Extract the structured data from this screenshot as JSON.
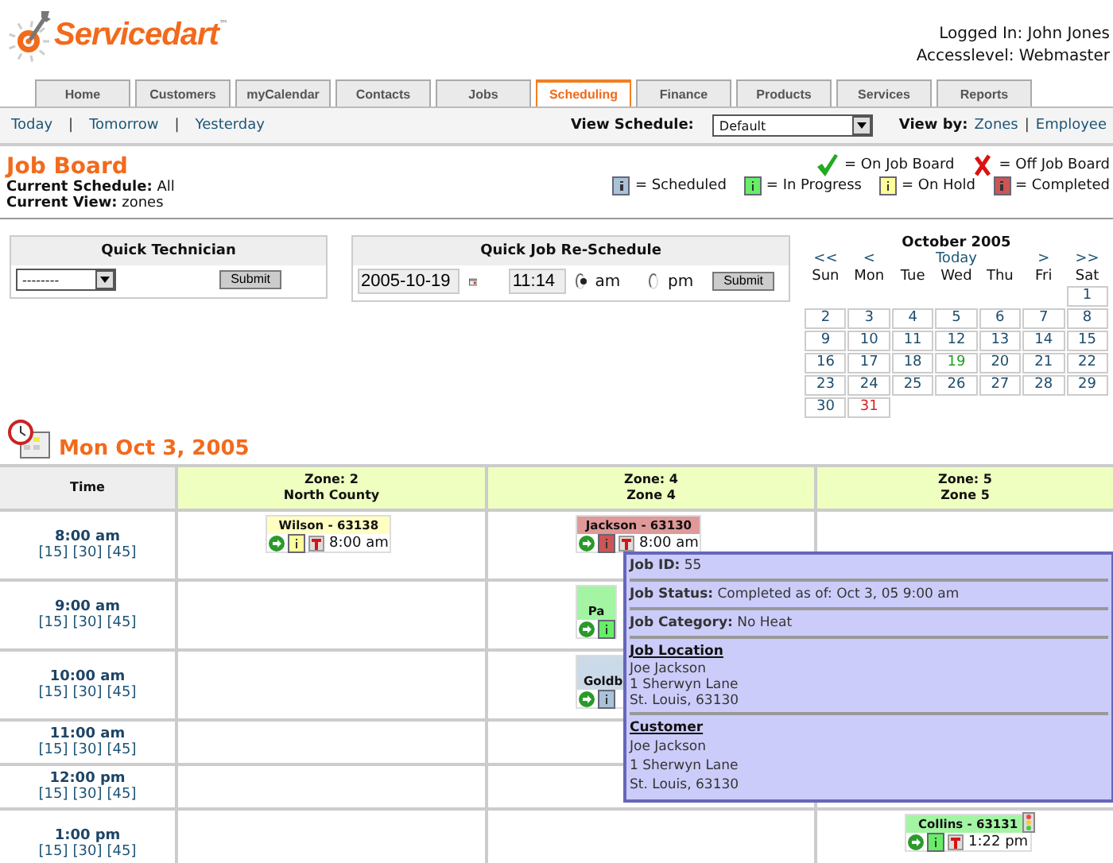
{
  "header": {
    "logo_text": "Servicedart",
    "logo_mark": "™",
    "user_info": [
      "Logged In: John Jones",
      "Accesslevel: Webmaster"
    ]
  },
  "nav_tabs": [
    {
      "label": "Home",
      "selected": false
    },
    {
      "label": "Customers",
      "selected": false
    },
    {
      "label": "myCalendar",
      "selected": false
    },
    {
      "label": "Contacts",
      "selected": false
    },
    {
      "label": "Jobs",
      "selected": false
    },
    {
      "label": "Scheduling",
      "selected": true
    },
    {
      "label": "Finance",
      "selected": false
    },
    {
      "label": "Products",
      "selected": false
    },
    {
      "label": "Services",
      "selected": false
    },
    {
      "label": "Reports",
      "selected": false
    }
  ],
  "subnav": {
    "links": [
      "Today",
      "Tomorrow",
      "Yesterday"
    ],
    "separator": "|",
    "view_schedule": {
      "label": "View Schedule:",
      "value": "Default"
    },
    "view_by": {
      "label": "View by:",
      "options": [
        "Zones",
        "Employee"
      ],
      "separator": "|"
    }
  },
  "job_board": {
    "title": "Job Board",
    "info": [
      {
        "label": "Current Schedule:",
        "value": "All"
      },
      {
        "label": "Current View:",
        "value": "zones"
      }
    ]
  },
  "legend": {
    "board": [
      {
        "kind": "check",
        "text": "= On Job Board"
      },
      {
        "kind": "cross",
        "text": "= Off Job Board"
      }
    ],
    "statuses": [
      {
        "color": "#a9c2d8",
        "text": "= Scheduled"
      },
      {
        "color": "#66ee66",
        "text": "= In Progress"
      },
      {
        "color": "#ffff99",
        "text": "= On Hold"
      },
      {
        "color": "#cc5555",
        "text": "= Completed"
      }
    ]
  },
  "quick_technician": {
    "title": "Quick Technician",
    "select_value": "--------",
    "button": "Submit"
  },
  "quick_reschedule": {
    "title": "Quick Job Re-Schedule",
    "date": "2005-10-19",
    "time": "11:14",
    "radios": [
      {
        "label": "am",
        "selected": true
      },
      {
        "label": "pm",
        "selected": false
      }
    ],
    "button": "Submit"
  },
  "calendar": {
    "title": "October 2005",
    "nav": [
      "<<",
      "<",
      "Today",
      ">",
      ">>"
    ],
    "weekdays": [
      "Sun",
      "Mon",
      "Tue",
      "Wed",
      "Thu",
      "Fri",
      "Sat"
    ],
    "weeks": [
      [
        {
          "label": "1",
          "kind": "day"
        }
      ],
      [
        {
          "label": "2",
          "kind": "day"
        },
        {
          "label": "3",
          "kind": "day"
        },
        {
          "label": "4",
          "kind": "day"
        },
        {
          "label": "5",
          "kind": "day"
        },
        {
          "label": "6",
          "kind": "day"
        },
        {
          "label": "7",
          "kind": "day"
        },
        {
          "label": "8",
          "kind": "day"
        }
      ],
      [
        {
          "label": "9",
          "kind": "day"
        },
        {
          "label": "10",
          "kind": "day"
        },
        {
          "label": "11",
          "kind": "day"
        },
        {
          "label": "12",
          "kind": "day"
        },
        {
          "label": "13",
          "kind": "day"
        },
        {
          "label": "14",
          "kind": "day"
        },
        {
          "label": "15",
          "kind": "day"
        }
      ],
      [
        {
          "label": "16",
          "kind": "day"
        },
        {
          "label": "17",
          "kind": "day"
        },
        {
          "label": "18",
          "kind": "day"
        },
        {
          "label": "19",
          "kind": "today"
        },
        {
          "label": "20",
          "kind": "day"
        },
        {
          "label": "21",
          "kind": "day"
        },
        {
          "label": "22",
          "kind": "day"
        }
      ],
      [
        {
          "label": "23",
          "kind": "day"
        },
        {
          "label": "24",
          "kind": "day"
        },
        {
          "label": "25",
          "kind": "day"
        },
        {
          "label": "26",
          "kind": "day"
        },
        {
          "label": "27",
          "kind": "day"
        },
        {
          "label": "28",
          "kind": "day"
        },
        {
          "label": "29",
          "kind": "day"
        }
      ],
      [
        {
          "label": "30",
          "kind": "day"
        },
        {
          "label": "31",
          "kind": "marked"
        }
      ]
    ]
  },
  "schedule": {
    "date_title": "Mon Oct 3, 2005",
    "time_header": "Time",
    "zones": [
      [
        "Zone: 2",
        "North County"
      ],
      [
        "Zone: 4",
        "Zone 4"
      ],
      [
        "Zone: 5",
        "Zone 5"
      ]
    ],
    "rows": [
      {
        "time": "8:00 am",
        "quarters": [
          "[15]",
          "[30]",
          "[45]"
        ],
        "cells": [
          [
            {
              "title": "Wilson - 63138",
              "color": "#ffff99",
              "time": "8:00 am"
            }
          ],
          [
            {
              "title": "Jackson - 63130",
              "color": "#cc5555",
              "time": "8:00 am"
            }
          ],
          []
        ]
      },
      {
        "time": "9:00 am",
        "quarters": [
          "[15]",
          "[30]",
          "[45]"
        ],
        "cells": [
          [],
          [
            {
              "title": "Pa",
              "color": "#66ee66"
            }
          ],
          []
        ]
      },
      {
        "time": "10:00 am",
        "quarters": [
          "[15]",
          "[30]",
          "[45]"
        ],
        "cells": [
          [],
          [
            {
              "title": "Goldb",
              "color": "#a9c2d8"
            }
          ],
          []
        ]
      },
      {
        "time": "11:00 am",
        "quarters": [
          "[15]",
          "[30]",
          "[45]"
        ],
        "cells": [
          [],
          [],
          []
        ]
      },
      {
        "time": "12:00 pm",
        "quarters": [
          "[15]",
          "[30]",
          "[45]"
        ],
        "cells": [
          [],
          [],
          []
        ]
      },
      {
        "time": "1:00 pm",
        "quarters": [
          "[15]",
          "[30]",
          "[45]"
        ],
        "cells": [
          [],
          [],
          [
            {
              "title": "Collins - 63131",
              "color": "#66ee66",
              "time": "1:22 pm",
              "signal": true
            }
          ]
        ]
      }
    ]
  },
  "tooltip": {
    "fields": [
      {
        "label": "Job ID:",
        "value": "55"
      },
      {
        "label": "Job Status:",
        "value": "Completed as of: Oct 3, 05 9:00 am"
      },
      {
        "label": "Job Category:",
        "value": "No Heat"
      }
    ],
    "sections": [
      {
        "heading": "Job Location",
        "lines": [
          "Joe Jackson",
          "1 Sherwyn Lane",
          "St. Louis, 63130"
        ],
        "kind": "address"
      },
      {
        "heading": "Customer",
        "lines": [
          "Joe Jackson",
          "1 Sherwyn Lane",
          "St. Louis, 63130"
        ],
        "kind": "contact"
      }
    ]
  }
}
